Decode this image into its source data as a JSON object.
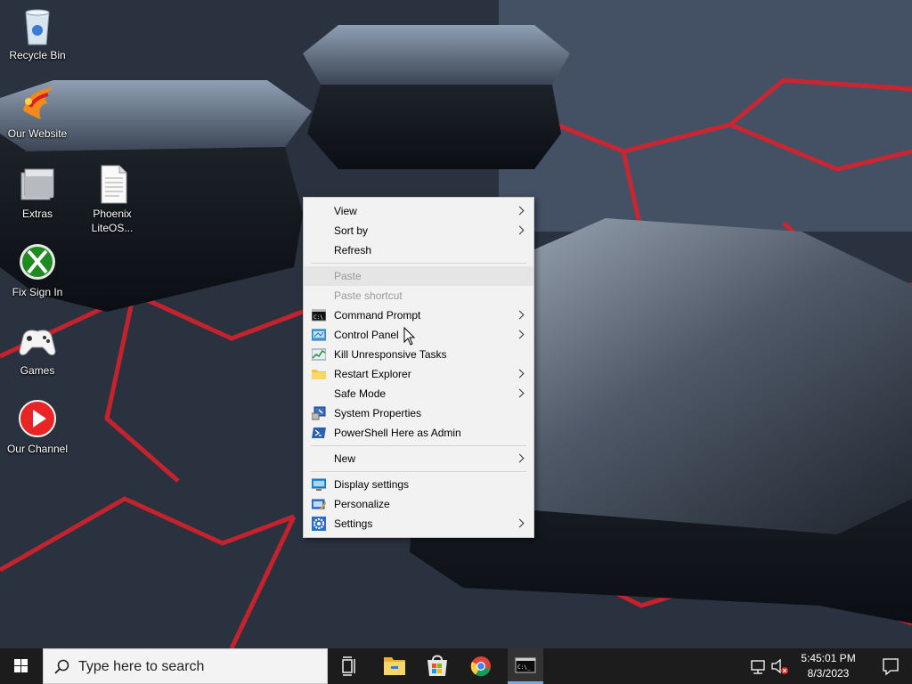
{
  "desktop": {
    "icons": [
      {
        "label": "Recycle Bin",
        "icon": "recycle-bin-icon"
      },
      {
        "label": "Our Website",
        "icon": "phoenix-bird-icon"
      },
      {
        "label": "Extras",
        "icon": "folder-stack-icon"
      },
      {
        "label": "Phoenix LiteOS...",
        "icon": "text-document-icon"
      },
      {
        "label": "Fix Sign In",
        "icon": "xbox-icon"
      },
      {
        "label": "Games",
        "icon": "gamepad-icon"
      },
      {
        "label": "Our Channel",
        "icon": "youtube-play-icon"
      }
    ]
  },
  "context_menu": {
    "items": [
      {
        "label": "View",
        "submenu": true,
        "enabled": true,
        "icon": ""
      },
      {
        "label": "Sort by",
        "submenu": true,
        "enabled": true,
        "icon": ""
      },
      {
        "label": "Refresh",
        "submenu": false,
        "enabled": true,
        "icon": ""
      },
      {
        "label": "Paste",
        "submenu": false,
        "enabled": false,
        "icon": ""
      },
      {
        "label": "Paste shortcut",
        "submenu": false,
        "enabled": false,
        "icon": ""
      },
      {
        "label": "Command Prompt",
        "submenu": true,
        "enabled": true,
        "icon": "command-prompt-icon"
      },
      {
        "label": "Control Panel",
        "submenu": true,
        "enabled": true,
        "icon": "control-panel-icon"
      },
      {
        "label": "Kill Unresponsive Tasks",
        "submenu": false,
        "enabled": true,
        "icon": "task-manager-icon"
      },
      {
        "label": "Restart Explorer",
        "submenu": true,
        "enabled": true,
        "icon": "folder-icon"
      },
      {
        "label": "Safe Mode",
        "submenu": true,
        "enabled": true,
        "icon": ""
      },
      {
        "label": "System Properties",
        "submenu": false,
        "enabled": true,
        "icon": "system-properties-icon"
      },
      {
        "label": "PowerShell Here as Admin",
        "submenu": false,
        "enabled": true,
        "icon": "powershell-icon"
      },
      {
        "label": "New",
        "submenu": true,
        "enabled": true,
        "icon": ""
      },
      {
        "label": "Display settings",
        "submenu": false,
        "enabled": true,
        "icon": "display-icon"
      },
      {
        "label": "Personalize",
        "submenu": false,
        "enabled": true,
        "icon": "personalize-icon"
      },
      {
        "label": "Settings",
        "submenu": true,
        "enabled": true,
        "icon": "settings-gear-icon"
      }
    ]
  },
  "taskbar": {
    "search_placeholder": "Type here to search",
    "pinned": [
      "task-view-icon",
      "file-explorer-icon",
      "microsoft-store-icon",
      "chrome-icon",
      "command-prompt-icon"
    ],
    "clock_time": "5:45:01 PM",
    "clock_date": "8/3/2023"
  },
  "colors": {
    "menu_bg": "#f2f2f2",
    "taskbar_bg": "#1c1c1c",
    "wallpaper_accent": "#e0202a",
    "active_underline": "#7aa7d8"
  }
}
